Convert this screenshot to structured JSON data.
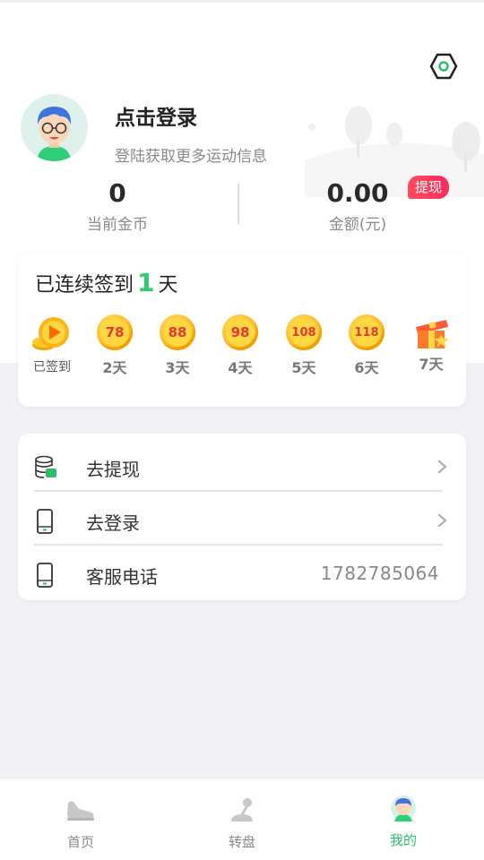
{
  "profile": {
    "login_title": "点击登录",
    "login_subtitle": "登陆获取更多运动信息"
  },
  "stats": {
    "coins_value": "0",
    "coins_label": "当前金币",
    "amount_value": "0.00",
    "amount_label": "金额(元)",
    "withdraw_badge": "提现"
  },
  "signin": {
    "prefix": "已连续签到",
    "days_count": "1",
    "suffix": "天",
    "days": [
      {
        "reward": "",
        "label": "已签到",
        "signed": true
      },
      {
        "reward": "78",
        "label": "2天"
      },
      {
        "reward": "88",
        "label": "3天"
      },
      {
        "reward": "98",
        "label": "4天"
      },
      {
        "reward": "108",
        "label": "5天"
      },
      {
        "reward": "118",
        "label": "6天"
      },
      {
        "reward": "",
        "label": "7天",
        "gift": true
      }
    ]
  },
  "menu": {
    "items": [
      {
        "label": "去提现",
        "icon": "wallet-icon",
        "has_arrow": true
      },
      {
        "label": "去登录",
        "icon": "phone-icon",
        "has_arrow": true
      },
      {
        "label": "客服电话",
        "icon": "phone-icon",
        "value": "1782785064"
      }
    ]
  },
  "tabbar": {
    "tabs": [
      {
        "label": "首页",
        "icon": "shoe-icon",
        "active": false
      },
      {
        "label": "转盘",
        "icon": "joystick-icon",
        "active": false
      },
      {
        "label": "我的",
        "icon": "avatar-icon",
        "active": true
      }
    ]
  },
  "colors": {
    "accent_green": "#2ebd6b",
    "badge_red": "#ff3b5c",
    "coin_gold": "#ffb21a"
  }
}
